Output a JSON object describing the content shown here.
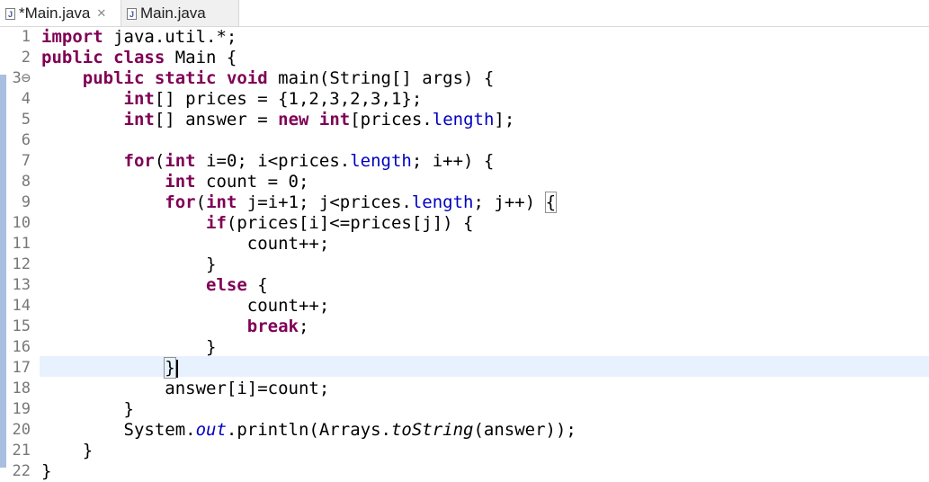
{
  "tabs": [
    {
      "label": "*Main.java",
      "close": "✕",
      "active": true
    },
    {
      "label": "Main.java",
      "active": false
    }
  ],
  "line_numbers": [
    "1",
    "2",
    "3⊖",
    "4",
    "5",
    "6",
    "7",
    "8",
    "9",
    "10",
    "11",
    "12",
    "13",
    "14",
    "15",
    "16",
    "17",
    "18",
    "19",
    "20",
    "21",
    "22"
  ],
  "code": {
    "l1_kw": "import",
    "l1_rest": " java.util.*;",
    "l2_kw1": "public",
    "l2_kw2": "class",
    "l2_rest": " Main {",
    "l3_kw1": "public",
    "l3_kw2": "static",
    "l3_kw3": "void",
    "l3_rest": " main(String[] args) {",
    "l4_kw": "int",
    "l4_rest": "[] prices = {1,2,3,2,3,1};",
    "l5_kw": "int",
    "l5_mid": "[] answer = ",
    "l5_kw2": "new",
    "l5_kw3": "int",
    "l5_a": "[prices.",
    "l5_fld": "length",
    "l5_b": "];",
    "l7_kw": "for",
    "l7_a": "(",
    "l7_kw2": "int",
    "l7_b": " i=0; i<prices.",
    "l7_fld": "length",
    "l7_c": "; i++) {",
    "l8_kw": "int",
    "l8_rest": " count = 0;",
    "l9_kw": "for",
    "l9_a": "(",
    "l9_kw2": "int",
    "l9_b": " j=i+1; j<prices.",
    "l9_fld": "length",
    "l9_c": "; j++) ",
    "l9_brace": "{",
    "l10_kw": "if",
    "l10_rest": "(prices[i]<=prices[j]) {",
    "l11": "count++;",
    "l12": "}",
    "l13_kw": "else",
    "l13_rest": " {",
    "l14": "count++;",
    "l15_kw": "break",
    "l15_rest": ";",
    "l16": "}",
    "l17": "}",
    "l18": "answer[i]=count;",
    "l19": "}",
    "l20_a": "System.",
    "l20_fld": "out",
    "l20_b": ".println(Arrays.",
    "l20_m": "toString",
    "l20_c": "(answer));",
    "l21": "}",
    "l22": "}"
  },
  "colors": {
    "keyword": "#7f0055",
    "field": "#0000c0",
    "current_line": "#e8f2fe"
  }
}
